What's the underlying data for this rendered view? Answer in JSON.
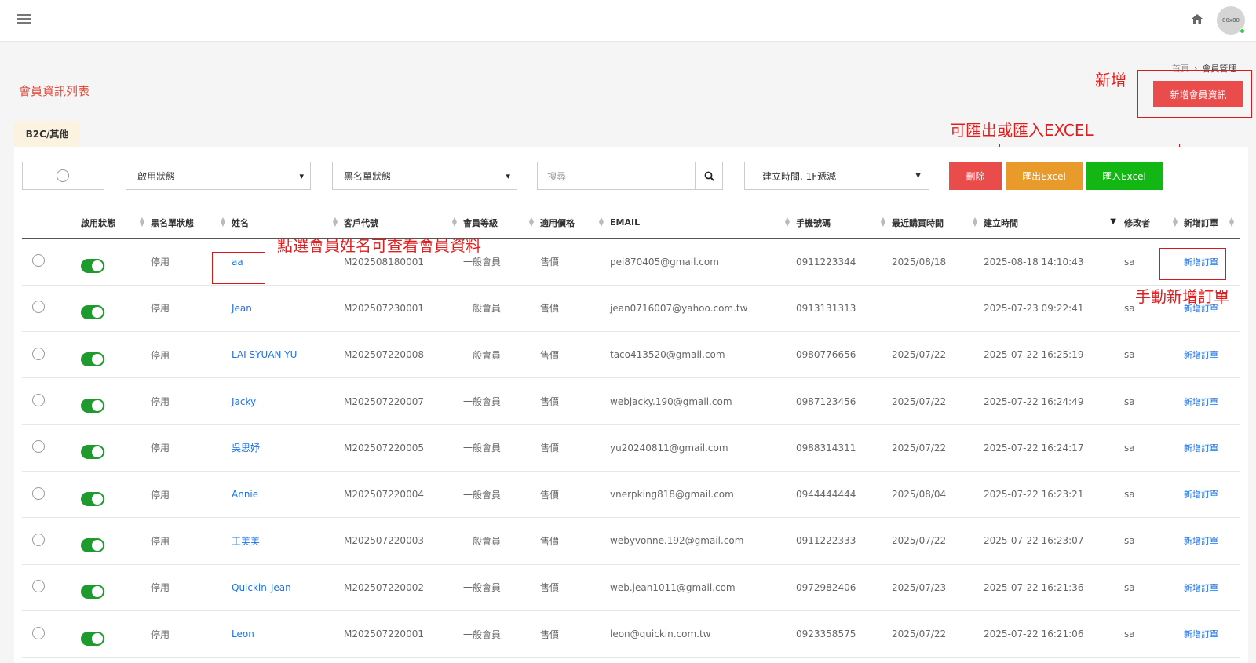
{
  "header": {
    "avatar_text": "80x80"
  },
  "breadcrumb": {
    "home": "首頁",
    "current": "會員管理"
  },
  "page_title": "會員資訊列表",
  "add_button": "新增會員資訊",
  "annotations": {
    "add": "新增",
    "excel": "可匯出或匯入EXCEL",
    "name": "點選會員姓名可查看會員資料",
    "order": "手動新增訂單"
  },
  "tab": "B2C/其他",
  "filters": {
    "status_select": "啟用狀態",
    "blacklist_select": "黑名單狀態",
    "search_placeholder": "搜尋",
    "sort_select": "建立時間, 1F遞減"
  },
  "actions": {
    "delete": "刪除",
    "export": "匯出Excel",
    "import": "匯入Excel"
  },
  "table": {
    "headers": [
      "",
      "啟用狀態",
      "黑名單狀態",
      "姓名",
      "客戶代號",
      "會員等級",
      "適用價格",
      "EMAIL",
      "手機號碼",
      "最近購買時間",
      "建立時間",
      "修改者",
      "新增訂單"
    ],
    "rows": [
      {
        "blacklist": "停用",
        "name": "aa",
        "code": "M202508180001",
        "level": "一般會員",
        "price": "售價",
        "email": "pei870405@gmail.com",
        "phone": "0911223344",
        "last_buy": "2025/08/18",
        "created": "2025-08-18 14:10:43",
        "editor": "sa",
        "order": "新增訂單"
      },
      {
        "blacklist": "停用",
        "name": "Jean",
        "code": "M202507230001",
        "level": "一般會員",
        "price": "售價",
        "email": "jean0716007@yahoo.com.tw",
        "phone": "0913131313",
        "last_buy": "",
        "created": "2025-07-23 09:22:41",
        "editor": "sa",
        "order": "新增訂單"
      },
      {
        "blacklist": "停用",
        "name": "LAI SYUAN YU",
        "code": "M202507220008",
        "level": "一般會員",
        "price": "售價",
        "email": "taco413520@gmail.com",
        "phone": "0980776656",
        "last_buy": "2025/07/22",
        "created": "2025-07-22 16:25:19",
        "editor": "sa",
        "order": "新增訂單"
      },
      {
        "blacklist": "停用",
        "name": "Jacky",
        "code": "M202507220007",
        "level": "一般會員",
        "price": "售價",
        "email": "webjacky.190@gmail.com",
        "phone": "0987123456",
        "last_buy": "2025/07/22",
        "created": "2025-07-22 16:24:49",
        "editor": "sa",
        "order": "新增訂單"
      },
      {
        "blacklist": "停用",
        "name": "吳思妤",
        "code": "M202507220005",
        "level": "一般會員",
        "price": "售價",
        "email": "yu20240811@gmail.com",
        "phone": "0988314311",
        "last_buy": "2025/07/22",
        "created": "2025-07-22 16:24:17",
        "editor": "sa",
        "order": "新增訂單"
      },
      {
        "blacklist": "停用",
        "name": "Annie",
        "code": "M202507220004",
        "level": "一般會員",
        "price": "售價",
        "email": "vnerpking818@gmail.com",
        "phone": "0944444444",
        "last_buy": "2025/08/04",
        "created": "2025-07-22 16:23:21",
        "editor": "sa",
        "order": "新增訂單"
      },
      {
        "blacklist": "停用",
        "name": "王美美",
        "code": "M202507220003",
        "level": "一般會員",
        "price": "售價",
        "email": "webyvonne.192@gmail.com",
        "phone": "0911222333",
        "last_buy": "2025/07/22",
        "created": "2025-07-22 16:23:07",
        "editor": "sa",
        "order": "新增訂單"
      },
      {
        "blacklist": "停用",
        "name": "Quickin-Jean",
        "code": "M202507220002",
        "level": "一般會員",
        "price": "售價",
        "email": "web.jean1011@gmail.com",
        "phone": "0972982406",
        "last_buy": "2025/07/23",
        "created": "2025-07-22 16:21:36",
        "editor": "sa",
        "order": "新增訂單"
      },
      {
        "blacklist": "停用",
        "name": "Leon",
        "code": "M202507220001",
        "level": "一般會員",
        "price": "售價",
        "email": "leon@quickin.com.tw",
        "phone": "0923358575",
        "last_buy": "2025/07/22",
        "created": "2025-07-22 16:21:06",
        "editor": "sa",
        "order": "新增訂單"
      }
    ]
  }
}
